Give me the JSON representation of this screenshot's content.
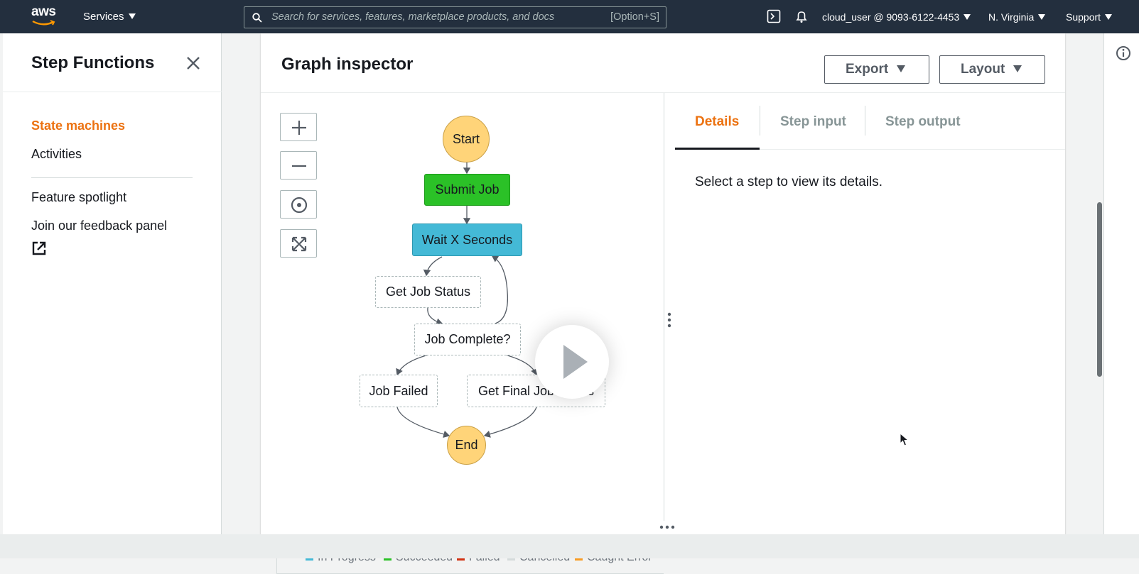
{
  "topnav": {
    "logo_text": "aws",
    "services_label": "Services",
    "search_placeholder": "Search for services, features, marketplace products, and docs",
    "search_shortcut": "[Option+S]",
    "account": "cloud_user @ 9093-6122-4453",
    "region": "N. Virginia",
    "support": "Support",
    "icons": [
      "cloudshell-icon",
      "bell-icon"
    ]
  },
  "sidebar": {
    "title": "Step Functions",
    "items": [
      {
        "label": "State machines",
        "active": true
      },
      {
        "label": "Activities"
      },
      {
        "label": "Feature spotlight"
      },
      {
        "label": "Join our feedback panel"
      }
    ]
  },
  "inspector": {
    "title": "Graph inspector",
    "export_label": "Export",
    "layout_label": "Layout",
    "zoom_controls": [
      "zoom-in-icon",
      "zoom-out-icon",
      "center-icon",
      "fit-icon"
    ],
    "nodes": {
      "start": "Start",
      "submit": "Submit Job",
      "wait": "Wait X Seconds",
      "status": "Get Job Status",
      "complete": "Job Complete?",
      "failed": "Job Failed",
      "final": "Get Final Job Status",
      "end": "End"
    },
    "legend": [
      {
        "label": "In Progress",
        "color": "#44b9d6"
      },
      {
        "label": "Succeeded",
        "color": "#2bc127"
      },
      {
        "label": "Failed",
        "color": "#d13212"
      },
      {
        "label": "Cancelled",
        "color": "#d5dbdb"
      },
      {
        "label": "Caught Error",
        "color": "#f89c24"
      }
    ]
  },
  "details": {
    "tabs": [
      "Details",
      "Step input",
      "Step output"
    ],
    "active_tab": "Details",
    "message": "Select a step to view its details."
  },
  "colors": {
    "nav_bg": "#232f3e",
    "accent": "#ec7211",
    "start_end": "#ffd479",
    "succeeded": "#2bc127",
    "in_progress": "#44b9d6"
  }
}
